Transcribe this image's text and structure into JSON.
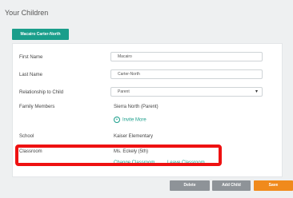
{
  "page": {
    "title": "Your Children"
  },
  "tab": {
    "label": "Macairo Carter-North"
  },
  "form": {
    "first_name": {
      "label": "First Name",
      "value": "Macairo"
    },
    "last_name": {
      "label": "Last Name",
      "value": "Carter-North"
    },
    "relationship": {
      "label": "Relationship to Child",
      "value": "Parent",
      "arrow": "▾"
    },
    "family": {
      "label": "Family Members",
      "value": "Sierra North (Parent)",
      "invite_label": "Invite More",
      "invite_icon": "+"
    },
    "school": {
      "label": "School",
      "value": "Kaiser Elementary"
    },
    "classroom": {
      "label": "Classroom",
      "value": "Ms. Eckely (5th)",
      "change_label": "Change Classroom",
      "leave_label": "Leave Classroom"
    }
  },
  "buttons": {
    "delete": "Delete",
    "add_child": "Add Child",
    "save": "Save"
  },
  "colors": {
    "accent": "#1a9e8b",
    "save": "#f08a1c",
    "gray_button": "#8e9398",
    "highlight": "#ee1111"
  }
}
